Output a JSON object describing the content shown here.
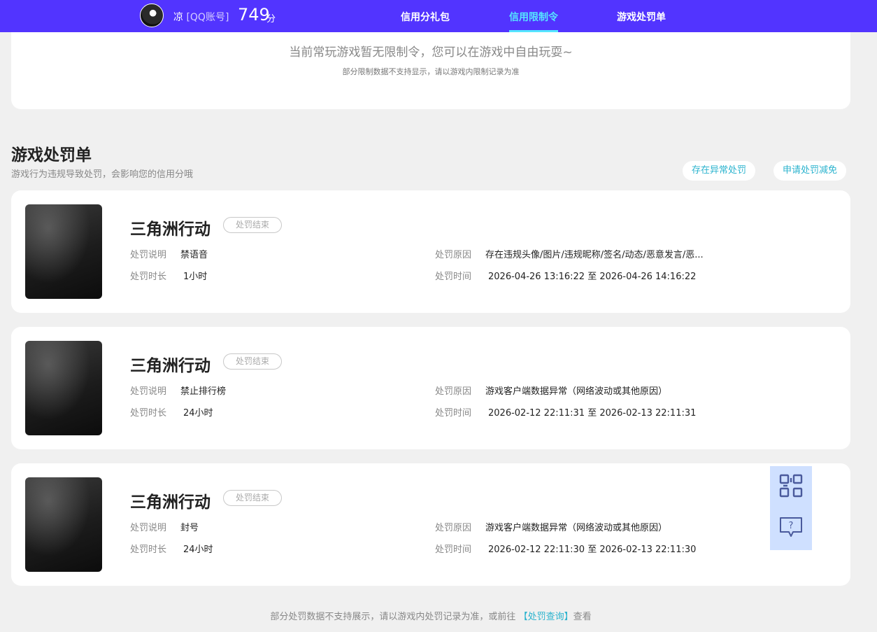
{
  "header": {
    "username": "凉",
    "account_type": "[QQ账号]",
    "score": "749",
    "score_unit": "分",
    "nav": [
      {
        "label": "信用分礼包",
        "active": false
      },
      {
        "label": "信用限制令",
        "active": true
      },
      {
        "label": "游戏处罚单",
        "active": false
      }
    ]
  },
  "restriction": {
    "message": "当前常玩游戏暂无限制令，您可以在游戏中自由玩耍~",
    "note": "部分限制数据不支持显示，请以游戏内限制记录为准"
  },
  "punishments_section": {
    "title": "游戏处罚单",
    "description": "游戏行为违规导致处罚，会影响您的信用分哦",
    "abnormal_button": "存在异常处罚",
    "appeal_button": "申请处罚减免"
  },
  "labels": {
    "desc": "处罚说明",
    "duration": "处罚时长",
    "reason": "处罚原因",
    "time": "处罚时间"
  },
  "punishments": [
    {
      "game": "三角洲行动",
      "status": "处罚结束",
      "desc": "禁语音",
      "duration": "1小时",
      "reason": "存在违规头像/图片/违规昵称/签名/动态/恶意发言/恶...",
      "time": "2026-04-26 13:16:22 至 2026-04-26 14:16:22"
    },
    {
      "game": "三角洲行动",
      "status": "处罚结束",
      "desc": "禁止排行榜",
      "duration": "24小时",
      "reason": "游戏客户端数据异常（网络波动或其他原因）",
      "time": "2026-02-12 22:11:31 至 2026-02-13 22:11:31"
    },
    {
      "game": "三角洲行动",
      "status": "处罚结束",
      "desc": "封号",
      "duration": "24小时",
      "reason": "游戏客户端数据异常（网络波动或其他原因）",
      "time": "2026-02-12 22:11:30 至 2026-02-13 22:11:30"
    }
  ],
  "footer": {
    "text_before": "部分处罚数据不支持展示，请以游戏内处罚记录为准，或前往",
    "link": "【处罚查询】",
    "text_after": "查看"
  },
  "floating": {
    "qr_icon": "qr-code-icon",
    "help_icon": "help-chat-icon"
  },
  "colors": {
    "topbar": "#5234ff",
    "accent": "#56e6ff",
    "link": "#2bb3ce"
  }
}
